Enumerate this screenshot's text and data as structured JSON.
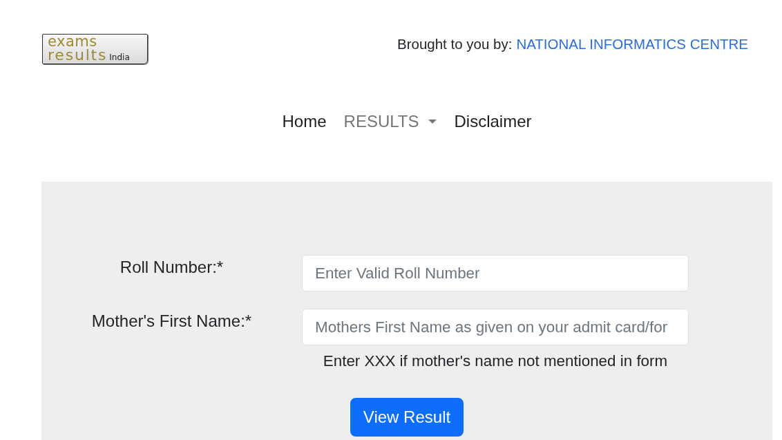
{
  "header": {
    "logo": {
      "line_1": "exams",
      "line_2": "results",
      "tag": "India"
    },
    "credit": {
      "prefix": "Brought to you by:",
      "link": "NATIONAL INFORMATICS CENTRE"
    }
  },
  "nav": {
    "items": [
      {
        "label": "Home",
        "kind": "link"
      },
      {
        "label": "RESULTS",
        "kind": "dropdown"
      },
      {
        "label": "Disclaimer",
        "kind": "link"
      }
    ]
  },
  "form": {
    "fields": [
      {
        "label": "Roll Number:*",
        "placeholder": "Enter Valid Roll Number"
      },
      {
        "label": "Mother's First Name:*",
        "placeholder": "Mothers First Name as given on your admit card/for",
        "hint": "Enter XXX if mother's name not mentioned in form"
      }
    ],
    "submit": {
      "label": "View Result"
    }
  }
}
